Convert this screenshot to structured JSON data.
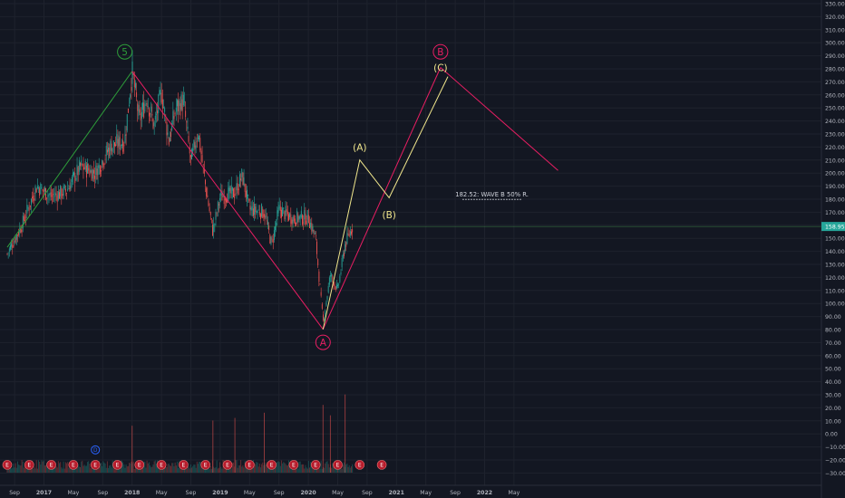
{
  "colors": {
    "background": "#131722",
    "grid": "#1e222d",
    "axis_text": "#b2b5be",
    "candle_up": "#26a69a",
    "candle_down": "#ef5350",
    "wave_green": "#2e9e3a",
    "wave_red": "#e91e63",
    "wave_yellow": "#f0e68c",
    "price_line": "#4caf50",
    "price_badge": "#26a69a",
    "earnings_badge": "#b71c2c",
    "dividend_badge": "#2962ff"
  },
  "chart_data": {
    "type": "line",
    "description_series": "Candlestick price chart with Elliott wave annotations",
    "x_axis": {
      "ticks": [
        "Sep",
        "2017",
        "May",
        "Sep",
        "2018",
        "May",
        "Sep",
        "2019",
        "May",
        "Sep",
        "2020",
        "May",
        "Sep",
        "2021",
        "May",
        "Sep",
        "2022",
        "May"
      ]
    },
    "y_axis": {
      "ticks": [
        "330.00",
        "320.00",
        "310.00",
        "300.00",
        "290.00",
        "280.00",
        "270.00",
        "260.00",
        "250.00",
        "240.00",
        "230.00",
        "220.00",
        "210.00",
        "200.00",
        "190.00",
        "180.00",
        "170.00",
        "160.00",
        "150.00",
        "140.00",
        "130.00",
        "120.00",
        "110.00",
        "100.00",
        "90.00",
        "80.00",
        "70.00",
        "60.00",
        "50.00",
        "40.00",
        "30.00",
        "20.00",
        "10.00",
        "0.00",
        "−10.00",
        "−20.00",
        "−30.00"
      ],
      "ylim": [
        -35,
        335
      ]
    },
    "current_price": {
      "value": 158.95,
      "label": "158.95"
    },
    "price_series": [
      {
        "date": "2016-08",
        "price": 138
      },
      {
        "date": "2016-10",
        "price": 160
      },
      {
        "date": "2016-12",
        "price": 190
      },
      {
        "date": "2017-02",
        "price": 182
      },
      {
        "date": "2017-04",
        "price": 186
      },
      {
        "date": "2017-06",
        "price": 205
      },
      {
        "date": "2017-08",
        "price": 200
      },
      {
        "date": "2017-10",
        "price": 220
      },
      {
        "date": "2017-12",
        "price": 225
      },
      {
        "date": "2018-01",
        "price": 278
      },
      {
        "date": "2018-02",
        "price": 240
      },
      {
        "date": "2018-03",
        "price": 258
      },
      {
        "date": "2018-04",
        "price": 236
      },
      {
        "date": "2018-05",
        "price": 262
      },
      {
        "date": "2018-06",
        "price": 225
      },
      {
        "date": "2018-07",
        "price": 250
      },
      {
        "date": "2018-08",
        "price": 255
      },
      {
        "date": "2018-09",
        "price": 208
      },
      {
        "date": "2018-10",
        "price": 232
      },
      {
        "date": "2018-11",
        "price": 190
      },
      {
        "date": "2018-12",
        "price": 155
      },
      {
        "date": "2019-01",
        "price": 182
      },
      {
        "date": "2019-03",
        "price": 185
      },
      {
        "date": "2019-04",
        "price": 198
      },
      {
        "date": "2019-05",
        "price": 172
      },
      {
        "date": "2019-07",
        "price": 170
      },
      {
        "date": "2019-08",
        "price": 145
      },
      {
        "date": "2019-09",
        "price": 172
      },
      {
        "date": "2019-11",
        "price": 165
      },
      {
        "date": "2020-01",
        "price": 166
      },
      {
        "date": "2020-02",
        "price": 150
      },
      {
        "date": "2020-03",
        "price": 85
      },
      {
        "date": "2020-04",
        "price": 122
      },
      {
        "date": "2020-05",
        "price": 110
      },
      {
        "date": "2020-06",
        "price": 145
      },
      {
        "date": "2020-07",
        "price": 158.95
      }
    ],
    "volume_spikes": [
      {
        "date": "2018-01",
        "value": 6
      },
      {
        "date": "2018-12",
        "value": 10
      },
      {
        "date": "2019-03",
        "value": 12
      },
      {
        "date": "2019-07",
        "value": 16
      },
      {
        "date": "2020-03",
        "value": 22
      },
      {
        "date": "2020-04",
        "value": 14
      },
      {
        "date": "2020-06",
        "value": 30
      }
    ],
    "wave_lines": [
      {
        "name": "impulse",
        "color_key": "wave_green",
        "points": [
          {
            "date": "2016-08",
            "price": 143
          },
          {
            "date": "2018-01",
            "price": 278
          }
        ]
      },
      {
        "name": "wave A",
        "color_key": "wave_red",
        "points": [
          {
            "date": "2018-01",
            "price": 278
          },
          {
            "date": "2020-03",
            "price": 80
          }
        ]
      },
      {
        "name": "wave B",
        "color_key": "wave_red",
        "points": [
          {
            "date": "2020-03",
            "price": 80
          },
          {
            "date": "2021-07",
            "price": 281
          }
        ]
      },
      {
        "name": "wave C",
        "color_key": "wave_red",
        "points": [
          {
            "date": "2021-07",
            "price": 281
          },
          {
            "date": "2022-11",
            "price": 202
          }
        ]
      },
      {
        "name": "sub-waves",
        "color_key": "wave_yellow",
        "points": [
          {
            "date": "2020-03",
            "price": 80
          },
          {
            "date": "2020-08",
            "price": 210
          },
          {
            "date": "2020-12",
            "price": 181
          },
          {
            "date": "2021-08",
            "price": 274
          }
        ]
      }
    ],
    "labels": [
      {
        "text": "5",
        "date": "2017-12",
        "price": 293,
        "style": "circle",
        "color_key": "wave_green"
      },
      {
        "text": "A",
        "date": "2020-03",
        "price": 70,
        "style": "circle",
        "color_key": "wave_red"
      },
      {
        "text": "B",
        "date": "2021-07",
        "price": 293,
        "style": "circle",
        "color_key": "wave_red"
      },
      {
        "text": "(A)",
        "date": "2020-08",
        "price": 220,
        "style": "plain",
        "color_key": "wave_yellow"
      },
      {
        "text": "(B)",
        "date": "2020-12",
        "price": 168,
        "style": "plain",
        "color_key": "wave_yellow"
      },
      {
        "text": "(C)",
        "date": "2021-07",
        "price": 281,
        "style": "plain",
        "color_key": "wave_yellow"
      }
    ],
    "annotation": {
      "text": "182.52: WAVE B 50% R.",
      "price": 182.52,
      "date_start": "2021-10",
      "date_end": "2022-06"
    },
    "event_badges": {
      "earnings_label": "E",
      "dividend_label": "D",
      "earnings_dates": [
        "2016-08",
        "2016-11",
        "2017-02",
        "2017-05",
        "2017-08",
        "2017-11",
        "2018-02",
        "2018-05",
        "2018-08",
        "2018-11",
        "2019-02",
        "2019-05",
        "2019-08",
        "2019-11",
        "2020-02",
        "2020-05",
        "2020-08",
        "2020-11"
      ],
      "dividend_dates": [
        "2017-08"
      ]
    }
  }
}
